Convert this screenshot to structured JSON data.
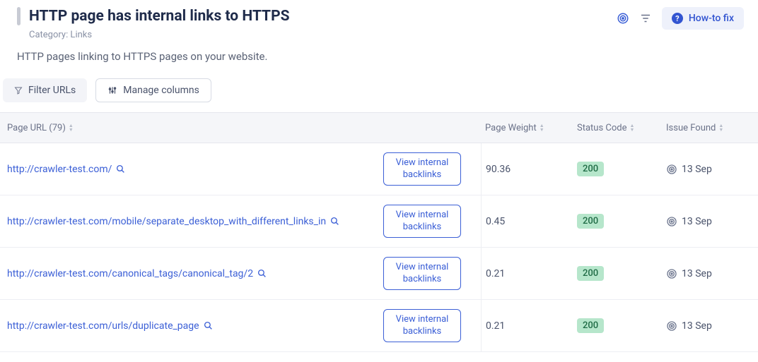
{
  "header": {
    "title": "HTTP page has internal links to HTTPS",
    "category_label": "Category: Links",
    "description": "HTTP pages linking to HTTPS pages on your website.",
    "howto_label": "How-to fix"
  },
  "controls": {
    "filter_label": "Filter URLs",
    "manage_cols_label": "Manage columns"
  },
  "columns": {
    "page_url": "Page URL (79)",
    "page_weight": "Page Weight",
    "status_code": "Status Code",
    "issue_found": "Issue Found"
  },
  "view_backlinks_label": "View internal backlinks",
  "rows": [
    {
      "url": "http://crawler-test.com/",
      "weight": "90.36",
      "status": "200",
      "found": "13 Sep"
    },
    {
      "url": "http://crawler-test.com/mobile/separate_desktop_with_different_links_in",
      "weight": "0.45",
      "status": "200",
      "found": "13 Sep"
    },
    {
      "url": "http://crawler-test.com/canonical_tags/canonical_tag/2",
      "weight": "0.21",
      "status": "200",
      "found": "13 Sep"
    },
    {
      "url": "http://crawler-test.com/urls/duplicate_page",
      "weight": "0.21",
      "status": "200",
      "found": "13 Sep"
    }
  ]
}
